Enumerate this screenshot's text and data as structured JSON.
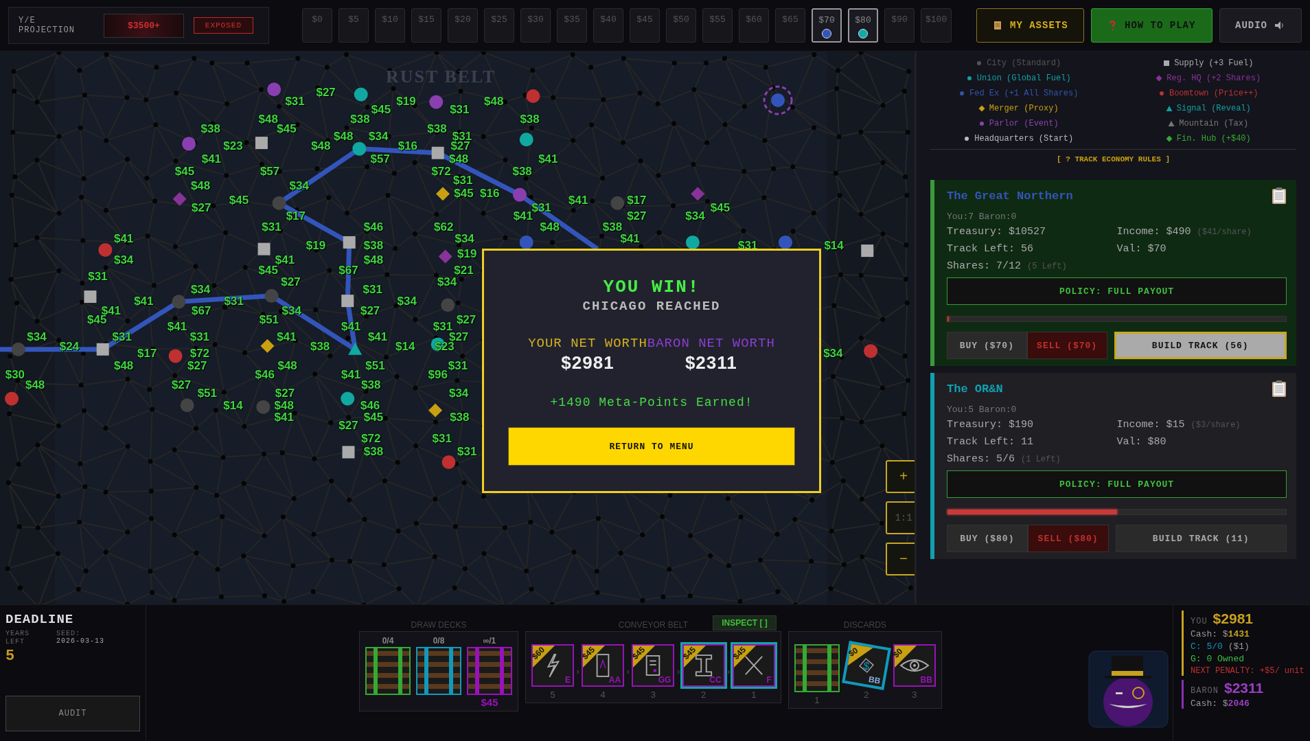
{
  "top_bar": {
    "projection_label": "Y/E PROJECTION",
    "projection_value": "$3500+",
    "exposure_badge": "EXPOSED",
    "price_track": [
      {
        "label": "$0",
        "selected": false
      },
      {
        "label": "$5",
        "selected": false
      },
      {
        "label": "$10",
        "selected": false
      },
      {
        "label": "$15",
        "selected": false
      },
      {
        "label": "$20",
        "selected": false
      },
      {
        "label": "$25",
        "selected": false
      },
      {
        "label": "$30",
        "selected": false
      },
      {
        "label": "$35",
        "selected": false
      },
      {
        "label": "$40",
        "selected": false
      },
      {
        "label": "$45",
        "selected": false
      },
      {
        "label": "$50",
        "selected": false
      },
      {
        "label": "$55",
        "selected": false
      },
      {
        "label": "$60",
        "selected": false
      },
      {
        "label": "$65",
        "selected": false
      },
      {
        "label": "$70",
        "selected": true,
        "color": "#3355bb"
      },
      {
        "label": "$80",
        "selected": true,
        "color": "#11aaaa"
      },
      {
        "label": "$90",
        "selected": false
      },
      {
        "label": "$100",
        "selected": false
      }
    ],
    "buttons": [
      {
        "kind": "assets",
        "label": "MY ASSETS"
      },
      {
        "kind": "help",
        "label": "HOW TO PLAY"
      },
      {
        "kind": "audio",
        "label": "AUDIO"
      }
    ]
  },
  "map": {
    "title": "RUST BELT",
    "prices": [
      "$27",
      "$31",
      "$19",
      "$48",
      "$45",
      "$31",
      "$48",
      "$38",
      "$38",
      "$38",
      "$45",
      "$38",
      "$48",
      "$34",
      "$31",
      "$23",
      "$48",
      "$16",
      "$27",
      "$41",
      "$57",
      "$48",
      "$41",
      "$45",
      "$57",
      "$72",
      "$38",
      "$31",
      "$48",
      "$34",
      "$45",
      "$16",
      "$45",
      "$41",
      "$17",
      "$27",
      "$31",
      "$45",
      "$17",
      "$41",
      "$27",
      "$34",
      "$31",
      "$46",
      "$62",
      "$48",
      "$38",
      "$41",
      "$34",
      "$41",
      "$19",
      "$38",
      "$31",
      "$14",
      "$19",
      "$34",
      "$41",
      "$48",
      "$45",
      "$67",
      "$21",
      "$31",
      "$27",
      "$34",
      "$34",
      "$31",
      "$41",
      "$31",
      "$34",
      "$41",
      "$67",
      "$34",
      "$27",
      "$45",
      "$51",
      "$27",
      "$41",
      "$41",
      "$31",
      "$34",
      "$31",
      "$31",
      "$41",
      "$41",
      "$27",
      "$24",
      "$38",
      "$14",
      "$23",
      "$17",
      "$72",
      "$34",
      "$48",
      "$27",
      "$48",
      "$51",
      "$31",
      "$30",
      "$46",
      "$41",
      "$96",
      "$48",
      "$27",
      "$38",
      "$51",
      "$27",
      "$34",
      "$14",
      "$48",
      "$46",
      "$41",
      "$45",
      "$38",
      "$27",
      "$72",
      "$31",
      "$38",
      "$31"
    ],
    "zoom_controls": [
      "+",
      "1:1",
      "−"
    ]
  },
  "modal": {
    "title": "YOU WIN!",
    "subtitle": "CHICAGO REACHED",
    "player_label": "YOUR NET WORTH",
    "player_value": "$2981",
    "baron_label": "BARON NET WORTH",
    "baron_value": "$2311",
    "reward": "+1490 Meta-Points Earned!",
    "button": "RETURN TO MENU"
  },
  "legend": {
    "left": [
      {
        "kind": "dot",
        "color": "#555555",
        "text": "City (Standard)"
      },
      {
        "kind": "dot",
        "color": "#11a0a0",
        "text": "Union (Global Fuel)"
      },
      {
        "kind": "dot",
        "color": "#3355aa",
        "text": "Fed Ex (+1 All Shares)"
      },
      {
        "kind": "diamond",
        "color": "#c8a010",
        "text": "Merger (Proxy)"
      },
      {
        "kind": "dot",
        "color": "#8844aa",
        "text": "Parlor (Event)"
      },
      {
        "kind": "dot",
        "color": "#bbbbbb",
        "text": "Headquarters (Start)"
      }
    ],
    "right": [
      {
        "kind": "square",
        "color": "#aaaaaa",
        "text": "Supply (+3 Fuel)"
      },
      {
        "kind": "diamond",
        "color": "#883399",
        "text": "Reg. HQ (+2 Shares)"
      },
      {
        "kind": "dot",
        "color": "#bb3333",
        "text": "Boomtown (Price++)"
      },
      {
        "kind": "triangle",
        "color": "#11a0a0",
        "text": "Signal (Reveal)"
      },
      {
        "kind": "triangle",
        "color": "#777777",
        "text": "Mountain (Tax)"
      },
      {
        "kind": "diamond",
        "color": "#33aa33",
        "text": "Fin. Hub (+$40)"
      }
    ],
    "rules_link": "[ ? TRACK ECONOMY RULES ]"
  },
  "companies": [
    {
      "name": "The Great Northern",
      "color": "#3355bb",
      "active": true,
      "holders": "You:7 Baron:0",
      "treasury": "Treasury: $10527",
      "income": "Income: $490",
      "per_share": "($41/share)",
      "track_left": "Track Left: 56",
      "value": "Val: $70",
      "shares": "Shares: 7/12",
      "shares_left": "(5 Left)",
      "policy": "POLICY: FULL PAYOUT",
      "level": 0,
      "buy": "BUY ($70)",
      "sell": "SELL ($70)",
      "build": "BUILD TRACK (56)",
      "build_selected": true
    },
    {
      "name": "The OR&N",
      "color": "#11a0b0",
      "active": false,
      "holders": "You:5 Baron:0",
      "treasury": "Treasury: $190",
      "income": "Income: $15",
      "per_share": "($3/share)",
      "track_left": "Track Left: 11",
      "value": "Val: $80",
      "shares": "Shares: 5/6",
      "shares_left": "(1 Left)",
      "policy": "POLICY: FULL PAYOUT",
      "level": 0.5,
      "buy": "BUY ($80)",
      "sell": "SELL ($80)",
      "build": "BUILD TRACK (11)",
      "build_selected": false
    }
  ],
  "bottom": {
    "deadline": {
      "title": "DEADLINE",
      "years_label": "YEARS LEFT",
      "years": "5",
      "seed_label": "SEED:",
      "seed": "2026-03-13",
      "audit": "AUDIT"
    },
    "draw_decks": {
      "title": "DRAW DECKS",
      "decks": [
        {
          "count": "0/4",
          "color": "#33aa33"
        },
        {
          "count": "0/8",
          "color": "#1199bb"
        },
        {
          "count": "∞/1",
          "color": "#9911bb",
          "price": "$45"
        }
      ]
    },
    "conveyor": {
      "title": "CONVEYOR BELT",
      "inspect": "INSPECT [ ]",
      "separator": "›",
      "cards": [
        {
          "kind": "bolt",
          "price": "$60",
          "code": "E",
          "slot": "5",
          "highlighted": false
        },
        {
          "kind": "door",
          "price": "$45",
          "code": "AA",
          "slot": "4",
          "highlighted": false
        },
        {
          "kind": "document",
          "price": "$45",
          "code": "GG",
          "slot": "3",
          "highlighted": false
        },
        {
          "kind": "beam",
          "price": "$45",
          "code": "CC",
          "slot": "2",
          "highlighted": true
        },
        {
          "kind": "cross",
          "price": "$45",
          "code": "F",
          "slot": "1",
          "highlighted": true
        }
      ]
    },
    "discards": {
      "title": "DISCARDS",
      "cards": [
        {
          "kind": "track",
          "color": "#33aa33",
          "slot": "1"
        },
        {
          "kind": "cash",
          "price": "$0",
          "symbol": "$",
          "code": "BB",
          "slot": "2"
        },
        {
          "kind": "eye",
          "price": "$0",
          "code": "BB",
          "slot": "3"
        }
      ]
    },
    "player": {
      "label": "YOU",
      "value": "$2981",
      "cash_label": "Cash: $",
      "cash": "1431",
      "coal": "C: 5/0",
      "coal_cost": "($1)",
      "grain": "G: 0 Owned",
      "penalty": "NEXT PENALTY: +$5/ unit"
    },
    "baron": {
      "label": "BARON",
      "value": "$2311",
      "cash_label": "Cash: $",
      "cash": "2046"
    }
  }
}
